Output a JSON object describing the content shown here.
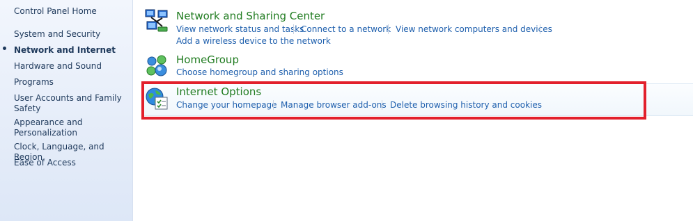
{
  "sidebar": {
    "home": "Control Panel Home",
    "items": [
      {
        "label": "System and Security"
      },
      {
        "label": "Network and Internet"
      },
      {
        "label": "Hardware and Sound"
      },
      {
        "label": "Programs"
      },
      {
        "label": "User Accounts and Family Safety"
      },
      {
        "label": "Appearance and Personalization"
      },
      {
        "label": "Clock, Language, and Region"
      },
      {
        "label": "Ease of Access"
      }
    ]
  },
  "sections": {
    "network_sharing": {
      "title": "Network and Sharing Center",
      "links": [
        "View network status and tasks",
        "Connect to a network",
        "View network computers and devices",
        "Add a wireless device to the network"
      ]
    },
    "homegroup": {
      "title": "HomeGroup",
      "links": [
        "Choose homegroup and sharing options"
      ]
    },
    "internet_options": {
      "title": "Internet Options",
      "links": [
        "Change your homepage",
        "Manage browser add-ons",
        "Delete browsing history and cookies"
      ]
    }
  },
  "icons": {
    "network_sharing": "network-sharing-center-icon",
    "homegroup": "homegroup-icon",
    "internet_options": "internet-options-icon"
  },
  "colors": {
    "title_green": "#217c21",
    "link_blue": "#1e5fad",
    "sidebar_text": "#1e395b",
    "highlight_red": "#e2202c"
  }
}
